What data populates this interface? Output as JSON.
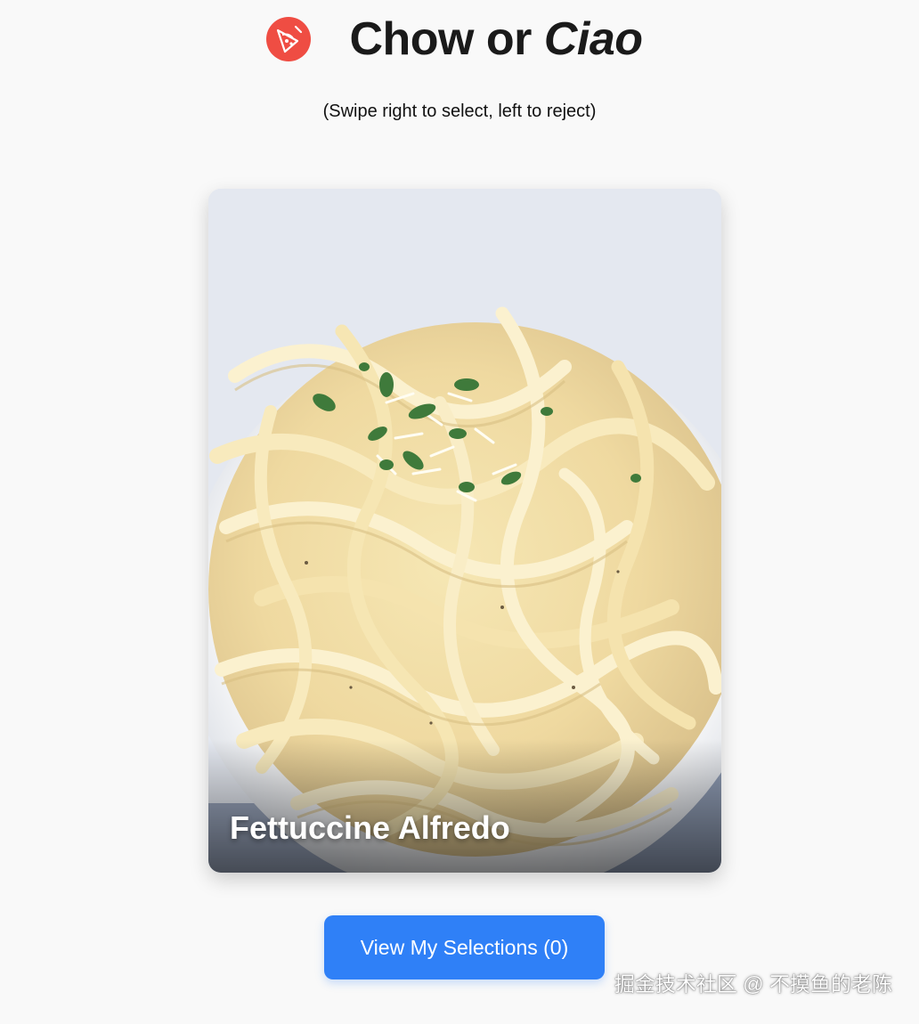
{
  "header": {
    "title_plain": "Chow or ",
    "title_italic": "Ciao",
    "logo_icon": "pizza-slice-icon",
    "logo_color": "#ef4d43"
  },
  "subtitle": "(Swipe right to select, left to reject)",
  "card": {
    "dish_name": "Fettuccine Alfredo",
    "image_icon": "pasta-photo"
  },
  "actions": {
    "view_selections_label": "View My Selections (0)",
    "accent_color": "#2f80f7"
  },
  "watermark": "掘金技术社区 @ 不摸鱼的老陈"
}
